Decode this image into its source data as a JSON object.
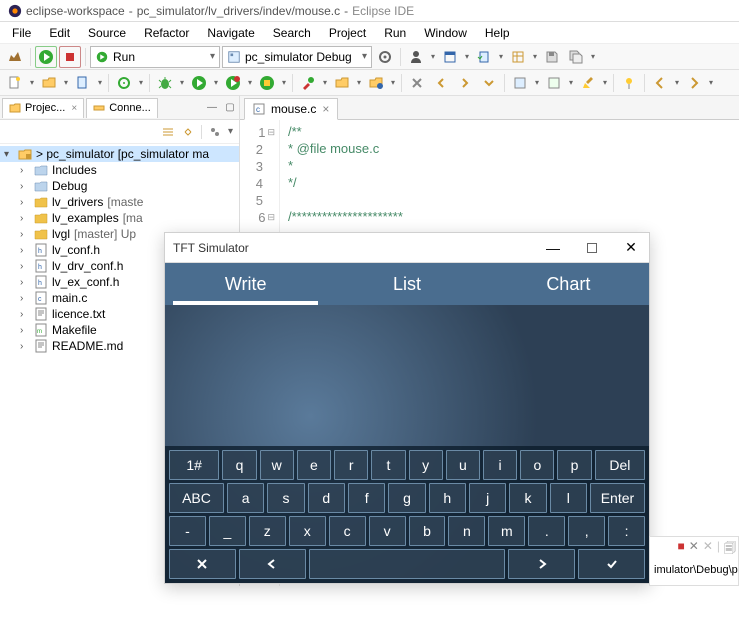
{
  "window": {
    "title_workspace": "eclipse-workspace",
    "title_path": "pc_simulator/lv_drivers/indev/mouse.c",
    "title_app": "Eclipse IDE"
  },
  "menu": [
    "File",
    "Edit",
    "Source",
    "Refactor",
    "Navigate",
    "Search",
    "Project",
    "Run",
    "Window",
    "Help"
  ],
  "run_combo": "Run",
  "launch_combo": "pc_simulator Debug",
  "views": {
    "project": "Projec...",
    "connections": "Conne..."
  },
  "tree": {
    "root": "> pc_simulator [pc_simulator ma",
    "items": [
      {
        "label": "Includes",
        "kind": "incl"
      },
      {
        "label": "Debug",
        "kind": "folder"
      },
      {
        "label": "lv_drivers",
        "dec": "[maste",
        "kind": "folder-y"
      },
      {
        "label": "lv_examples",
        "dec": "[ma",
        "kind": "folder-y"
      },
      {
        "label": "lvgl",
        "dec": "[master] Up",
        "kind": "folder-y"
      },
      {
        "label": "lv_conf.h",
        "kind": "h"
      },
      {
        "label": "lv_drv_conf.h",
        "kind": "h"
      },
      {
        "label": "lv_ex_conf.h",
        "kind": "h"
      },
      {
        "label": "main.c",
        "kind": "c"
      },
      {
        "label": "licence.txt",
        "kind": "txt"
      },
      {
        "label": "Makefile",
        "kind": "mk"
      },
      {
        "label": "README.md",
        "kind": "md"
      }
    ]
  },
  "editor": {
    "tab": "mouse.c",
    "lines": [
      {
        "n": "1",
        "fold": "⊟",
        "text": "/**"
      },
      {
        "n": "2",
        "fold": "",
        "text": " * @file mouse.c"
      },
      {
        "n": "3",
        "fold": "",
        "text": " *"
      },
      {
        "n": "4",
        "fold": "",
        "text": " */"
      },
      {
        "n": "5",
        "fold": "",
        "text": ""
      },
      {
        "n": "6",
        "fold": "⊟",
        "text": "/**********************"
      }
    ]
  },
  "sim": {
    "title": "TFT Simulator",
    "tabs": [
      "Write",
      "List",
      "Chart"
    ],
    "kbd": [
      [
        "1#",
        "q",
        "w",
        "e",
        "r",
        "t",
        "y",
        "u",
        "i",
        "o",
        "p",
        "Del"
      ],
      [
        "ABC",
        "a",
        "s",
        "d",
        "f",
        "g",
        "h",
        "j",
        "k",
        "l",
        "Enter"
      ],
      [
        "-",
        "_",
        "z",
        "x",
        "c",
        "v",
        "b",
        "n",
        "m",
        ".",
        ",",
        ":"
      ]
    ]
  },
  "console": {
    "path": "imulator\\Debug\\p"
  }
}
